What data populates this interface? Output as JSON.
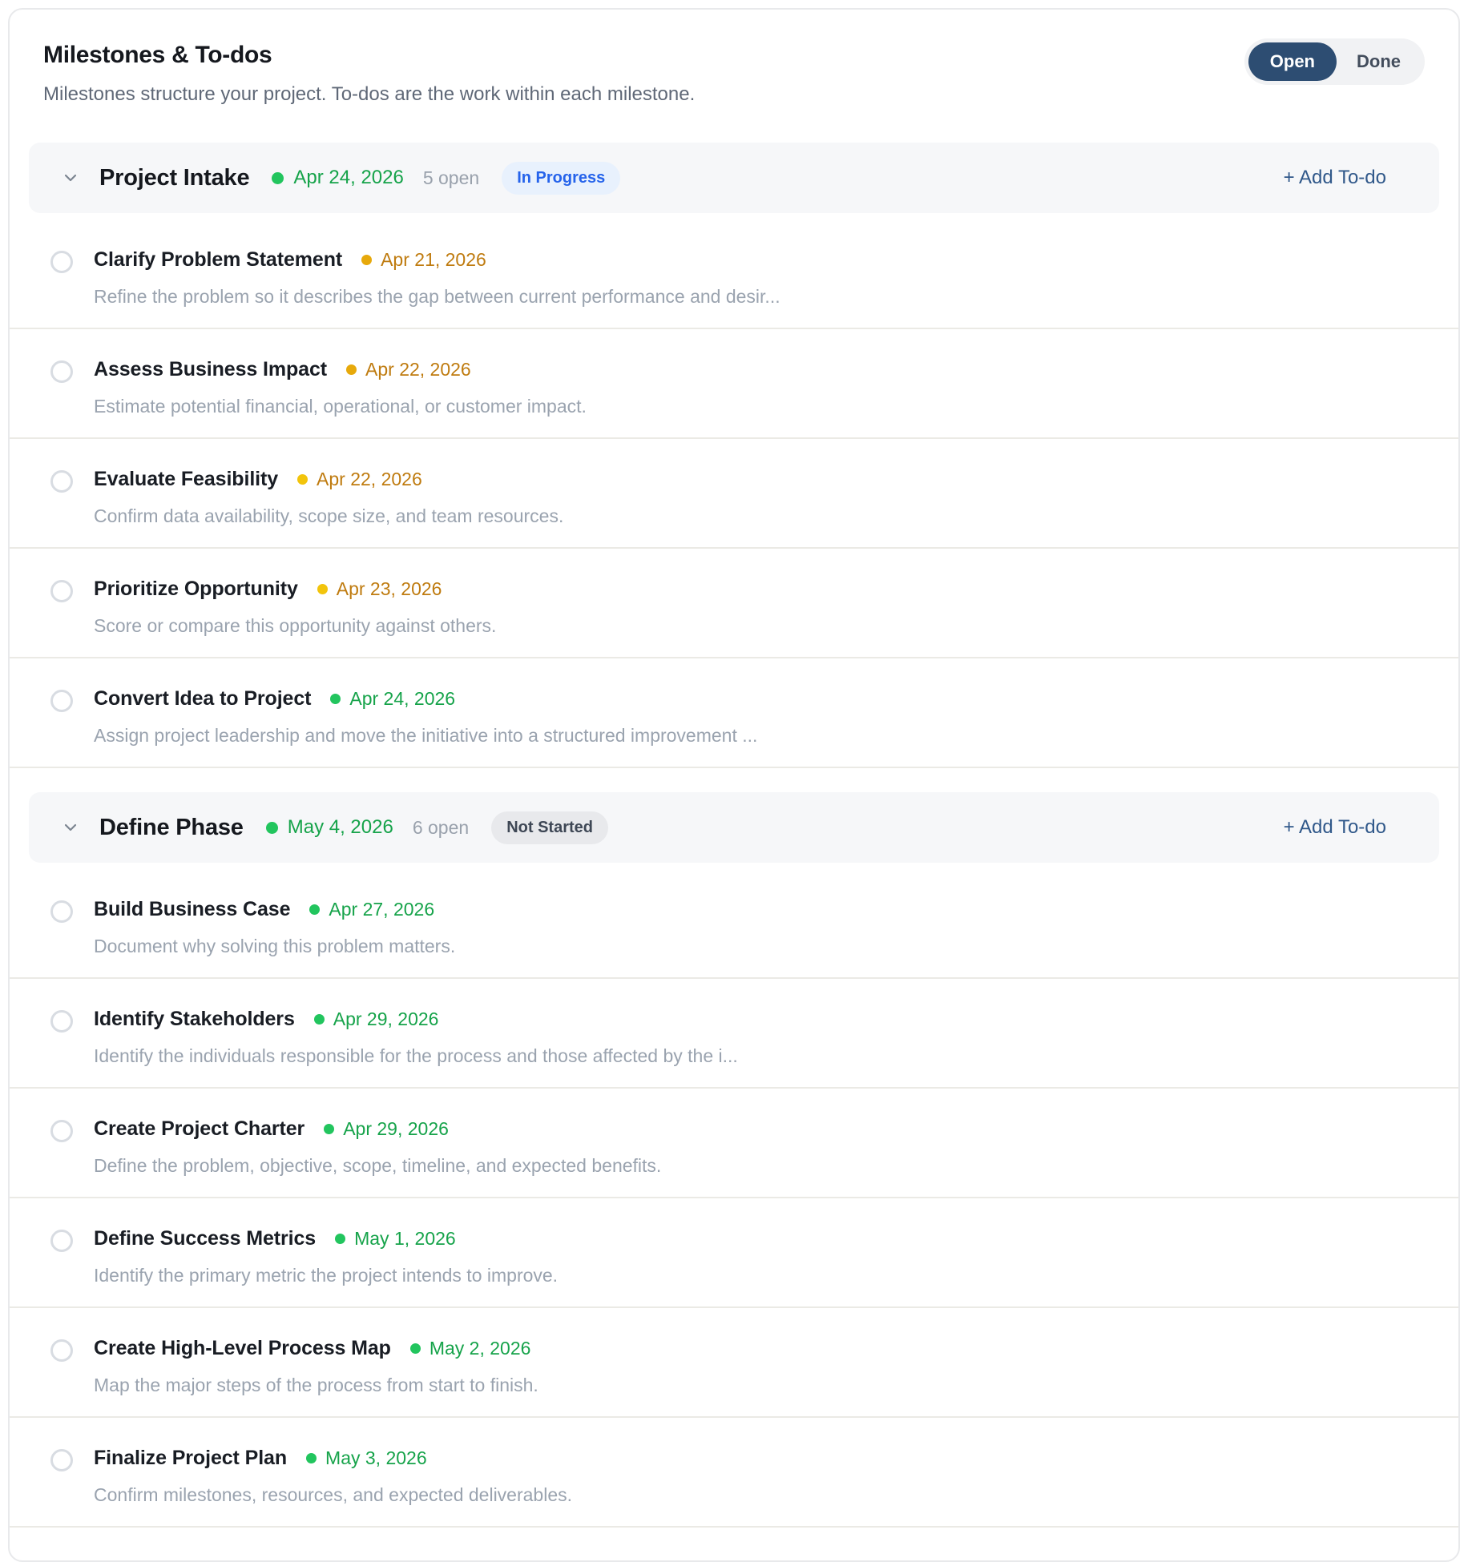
{
  "header": {
    "title": "Milestones & To-dos",
    "subtitle": "Milestones structure your project. To-dos are the work within each milestone.",
    "toggle": {
      "open_label": "Open",
      "done_label": "Done",
      "active": "Open"
    }
  },
  "colors": {
    "accent_navy": "#2d4d72",
    "toggle_bg": "#f1f2f4",
    "add_link": "#30588a",
    "milestone_header_bg": "#f6f7f9",
    "divider": "#ebeae5",
    "green_dot": "#22c55e",
    "green_text": "#16a34a",
    "amber_dot": "#e7a90b",
    "yellow_dot": "#f2c40c",
    "amber_text": "#bf7b0f",
    "badge_inprogress_bg": "#e8f1fd",
    "badge_inprogress_text": "#2563eb",
    "badge_notstarted_bg": "#e8e9ec",
    "badge_notstarted_text": "#3e4755"
  },
  "milestones": [
    {
      "name": "Project Intake",
      "date": "Apr 24, 2026",
      "date_color": "#16a34a",
      "dot_color": "#22c55e",
      "open_count": "5 open",
      "status": {
        "label": "In Progress",
        "text_color": "#2563eb",
        "bg_color": "#e8f1fd"
      },
      "add_label": "+ Add To-do",
      "todos": [
        {
          "title": "Clarify Problem Statement",
          "date": "Apr 21, 2026",
          "dot_color": "#e7a90b",
          "date_color": "#bf7b0f",
          "description": "Refine the problem so it describes the gap between current performance and desir..."
        },
        {
          "title": "Assess Business Impact",
          "date": "Apr 22, 2026",
          "dot_color": "#e7a90b",
          "date_color": "#bf7b0f",
          "description": "Estimate potential financial, operational, or customer impact."
        },
        {
          "title": "Evaluate Feasibility",
          "date": "Apr 22, 2026",
          "dot_color": "#f2c40c",
          "date_color": "#bf7b0f",
          "description": "Confirm data availability, scope size, and team resources."
        },
        {
          "title": "Prioritize Opportunity",
          "date": "Apr 23, 2026",
          "dot_color": "#f2c40c",
          "date_color": "#bf7b0f",
          "description": "Score or compare this opportunity against others."
        },
        {
          "title": "Convert Idea to Project",
          "date": "Apr 24, 2026",
          "dot_color": "#22c55e",
          "date_color": "#16a34a",
          "description": "Assign project leadership and move the initiative into a structured improvement ..."
        }
      ]
    },
    {
      "name": "Define Phase",
      "date": "May 4, 2026",
      "date_color": "#16a34a",
      "dot_color": "#22c55e",
      "open_count": "6 open",
      "status": {
        "label": "Not Started",
        "text_color": "#3e4755",
        "bg_color": "#e8e9ec"
      },
      "add_label": "+ Add To-do",
      "todos": [
        {
          "title": "Build Business Case",
          "date": "Apr 27, 2026",
          "dot_color": "#22c55e",
          "date_color": "#16a34a",
          "description": "Document why solving this problem matters."
        },
        {
          "title": "Identify Stakeholders",
          "date": "Apr 29, 2026",
          "dot_color": "#22c55e",
          "date_color": "#16a34a",
          "description": "Identify the individuals responsible for the process and those affected by the i..."
        },
        {
          "title": "Create Project Charter",
          "date": "Apr 29, 2026",
          "dot_color": "#22c55e",
          "date_color": "#16a34a",
          "description": "Define the problem, objective, scope, timeline, and expected benefits."
        },
        {
          "title": "Define Success Metrics",
          "date": "May 1, 2026",
          "dot_color": "#22c55e",
          "date_color": "#16a34a",
          "description": "Identify the primary metric the project intends to improve."
        },
        {
          "title": "Create High-Level Process Map",
          "date": "May 2, 2026",
          "dot_color": "#22c55e",
          "date_color": "#16a34a",
          "description": "Map the major steps of the process from start to finish."
        },
        {
          "title": "Finalize Project Plan",
          "date": "May 3, 2026",
          "dot_color": "#22c55e",
          "date_color": "#16a34a",
          "description": "Confirm milestones, resources, and expected deliverables."
        }
      ]
    }
  ]
}
